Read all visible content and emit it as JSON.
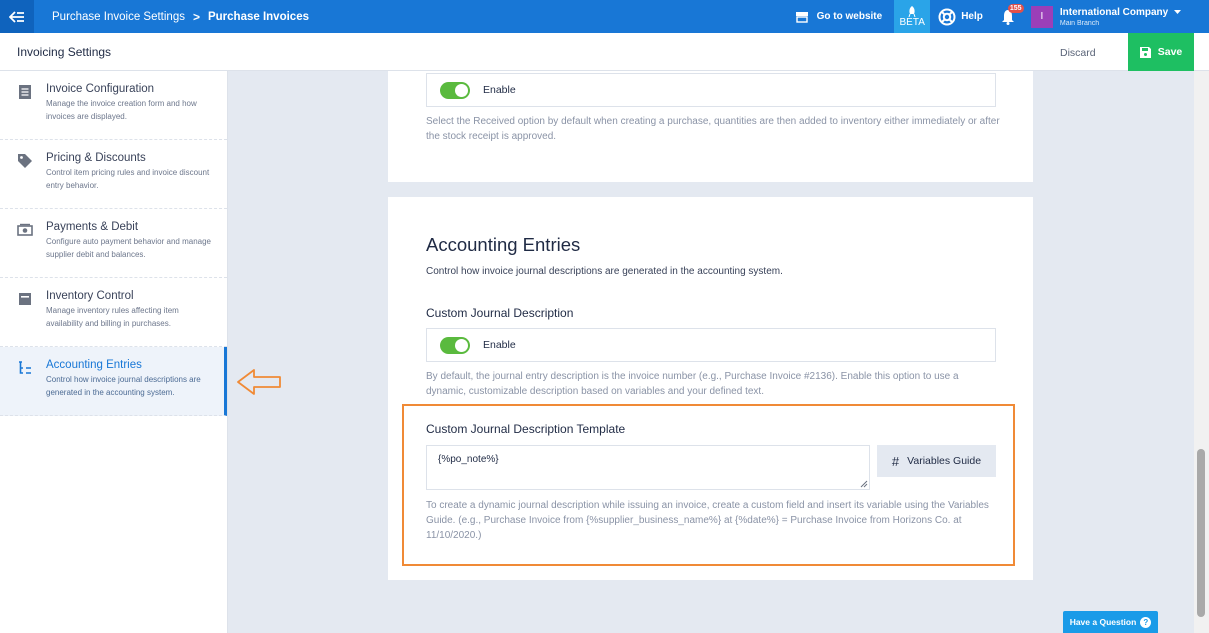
{
  "topbar": {
    "breadcrumb_parent": "Purchase Invoice Settings",
    "breadcrumb_separator": ">",
    "breadcrumb_current": "Purchase Invoices",
    "goto_website": "Go to website",
    "beta": "BETA",
    "help": "Help",
    "notifications_count": "155",
    "avatar_letter": "I",
    "company_name": "International Company",
    "company_branch": "Main Branch"
  },
  "header": {
    "title": "Invoicing Settings",
    "discard": "Discard",
    "save": "Save"
  },
  "sidebar": {
    "items": [
      {
        "label": "Invoice Configuration",
        "desc": "Manage the invoice creation form and how invoices are displayed.",
        "icon": "document-list-icon"
      },
      {
        "label": "Pricing & Discounts",
        "desc": "Control item pricing rules and invoice discount entry behavior.",
        "icon": "tag-icon"
      },
      {
        "label": "Payments & Debit",
        "desc": "Configure auto payment behavior and manage supplier debit and balances.",
        "icon": "cash-icon"
      },
      {
        "label": "Inventory Control",
        "desc": "Manage inventory rules affecting item availability and billing in purchases.",
        "icon": "inventory-box-icon"
      },
      {
        "label": "Accounting Entries",
        "desc": "Control how invoice journal descriptions are generated in the accounting system.",
        "icon": "tree-structure-icon"
      }
    ],
    "active_index": 4
  },
  "inventory_card": {
    "toggle_label": "Enable",
    "help": "Select the Received option by default when creating a purchase, quantities are then added to inventory either immediately or after the stock receipt is approved."
  },
  "accounting": {
    "title": "Accounting Entries",
    "desc": "Control how invoice journal descriptions are generated in the accounting system.",
    "custom_label": "Custom Journal Description",
    "toggle_label": "Enable",
    "toggle_help": "By default, the journal entry description is the invoice number (e.g., Purchase Invoice #2136). Enable this option to use a dynamic, customizable description based on variables and your defined text.",
    "template_label": "Custom Journal Description Template",
    "template_value": "{%po_note%}",
    "variables_guide": "Variables Guide",
    "template_help": "To create a dynamic journal description while issuing an invoice, create a custom field and insert its variable using the Variables Guide. (e.g., Purchase Invoice from {%supplier_business_name%} at {%date%} = Purchase Invoice from Horizons Co. at 11/10/2020.)"
  },
  "have_question": "Have a Question",
  "colors": {
    "primary": "#1877d6",
    "save_green": "#1ebf62",
    "toggle_green": "#5aba3e",
    "highlight_orange": "#f08a36"
  }
}
